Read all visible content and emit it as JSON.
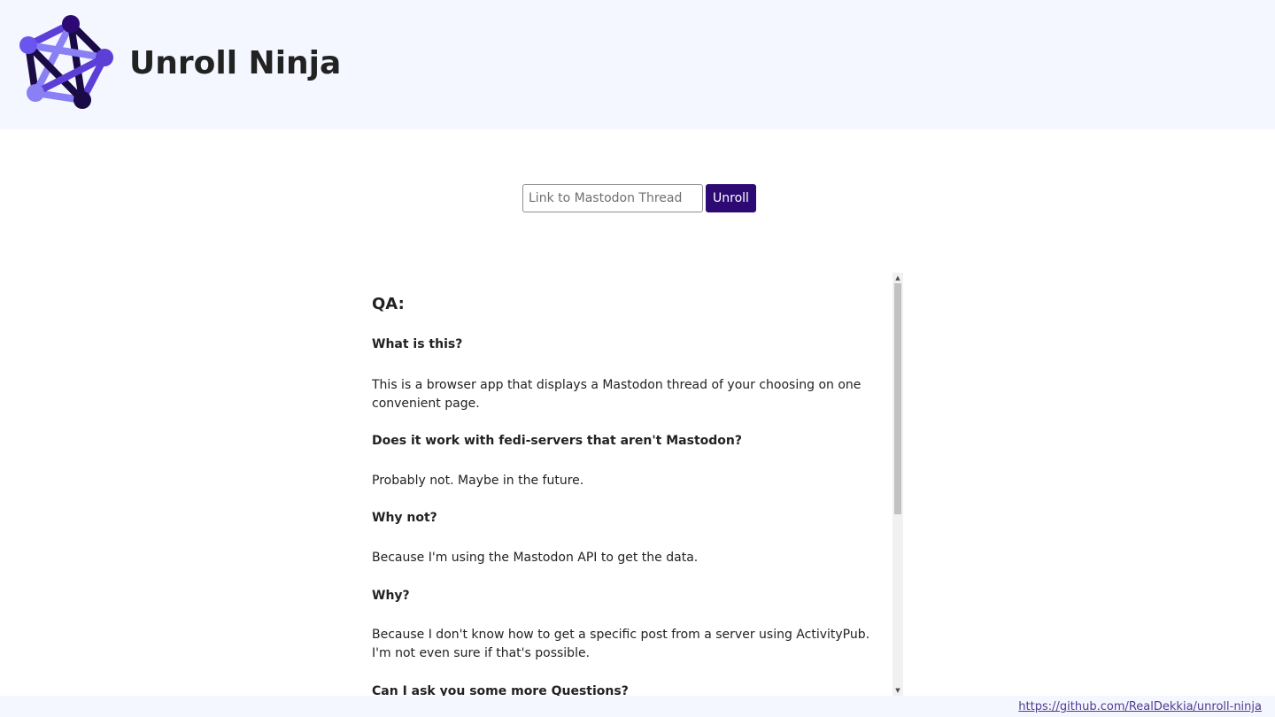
{
  "header": {
    "title": "Unroll Ninja",
    "logo_icon": "network-pentagon-icon",
    "colors": {
      "background": "#f4f7ff",
      "logo_dark": "#1a0a45",
      "logo_mid": "#5c3fd6",
      "logo_light": "#8a80f5"
    }
  },
  "form": {
    "input_placeholder": "Link to Mastodon Thread",
    "input_value": "",
    "button_label": "Unroll",
    "button_color": "#2d0a73"
  },
  "content": {
    "heading": "QA:",
    "qa": [
      {
        "question": "What is this?",
        "answer": "This is a browser app that displays a Mastodon thread of your choosing on one convenient page."
      },
      {
        "question": "Does it work with fedi-servers that aren't Mastodon?",
        "answer": "Probably not. Maybe in the future."
      },
      {
        "question": "Why not?",
        "answer": "Because I'm using the Mastodon API to get the data."
      },
      {
        "question": "Why?",
        "answer": "Because I don't know how to get a specific post from a server using ActivityPub. I'm not even sure if that's possible."
      },
      {
        "question": "Can I ask you some more Questions?",
        "answer": ""
      }
    ]
  },
  "scrollbar": {
    "up_arrow": "▲",
    "down_arrow": "▼"
  },
  "footer": {
    "link_text": "https://github.com/RealDekkia/unroll-ninja",
    "link_color": "#55398f"
  }
}
